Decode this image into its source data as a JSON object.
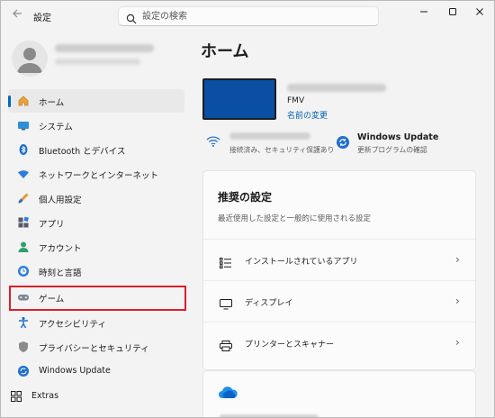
{
  "window": {
    "title": "設定",
    "back_icon": "back-arrow-icon",
    "controls": [
      "minimize-icon",
      "maximize-icon",
      "close-icon"
    ]
  },
  "search": {
    "placeholder": "設定の検索",
    "icon": "search-icon"
  },
  "sidebar": {
    "items": [
      {
        "label": "ホーム",
        "icon": "home-icon",
        "selected": true
      },
      {
        "label": "システム",
        "icon": "system-icon"
      },
      {
        "label": "Bluetooth とデバイス",
        "icon": "bluetooth-icon"
      },
      {
        "label": "ネットワークとインターネット",
        "icon": "network-icon"
      },
      {
        "label": "個人用設定",
        "icon": "personalization-icon"
      },
      {
        "label": "アプリ",
        "icon": "apps-icon"
      },
      {
        "label": "アカウント",
        "icon": "account-icon"
      },
      {
        "label": "時刻と言語",
        "icon": "time-language-icon"
      },
      {
        "label": "ゲーム",
        "icon": "gaming-icon",
        "highlighted": true
      },
      {
        "label": "アクセシビリティ",
        "icon": "accessibility-icon"
      },
      {
        "label": "プライバシーとセキュリティ",
        "icon": "privacy-shield-icon"
      },
      {
        "label": "Windows Update",
        "icon": "windows-update-icon"
      },
      {
        "label": "Extras",
        "icon": "extras-icon"
      }
    ]
  },
  "main": {
    "title": "ホーム",
    "device": {
      "model": "FMV",
      "rename_link": "名前の変更"
    },
    "network_status": "接続済み、セキュリティ保護あり",
    "windows_update": {
      "title": "Windows Update",
      "subtitle": "更新プログラムの確認"
    },
    "recommended": {
      "title": "推奨の設定",
      "subtitle": "最近使用した設定と一般的に使用される設定",
      "rows": [
        {
          "label": "インストールされているアプリ",
          "icon": "installed-apps-icon"
        },
        {
          "label": "ディスプレイ",
          "icon": "display-icon"
        },
        {
          "label": "プリンターとスキャナー",
          "icon": "printer-icon"
        }
      ]
    }
  },
  "colors": {
    "accent": "#0067c0",
    "link": "#005fb8",
    "highlight_border": "#d9202a",
    "device_screen": "#0a4fa3"
  }
}
